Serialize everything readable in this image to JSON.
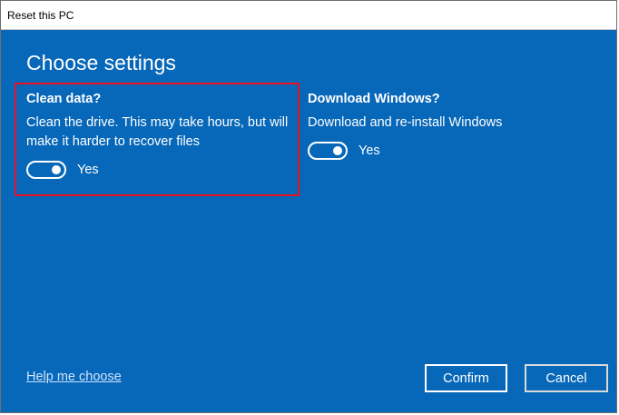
{
  "window": {
    "title": "Reset this PC"
  },
  "heading": "Choose settings",
  "clean_data": {
    "title": "Clean data?",
    "description": "Clean the drive. This may take hours, but will make it harder to recover files",
    "toggle_state": "Yes",
    "enabled": true
  },
  "download_windows": {
    "title": "Download Windows?",
    "description": "Download and re-install Windows",
    "toggle_state": "Yes",
    "enabled": true
  },
  "footer": {
    "help_link": "Help me choose",
    "confirm_label": "Confirm",
    "cancel_label": "Cancel"
  },
  "colors": {
    "background": "#0767b8",
    "highlight": "#e81123",
    "text": "#ffffff"
  }
}
